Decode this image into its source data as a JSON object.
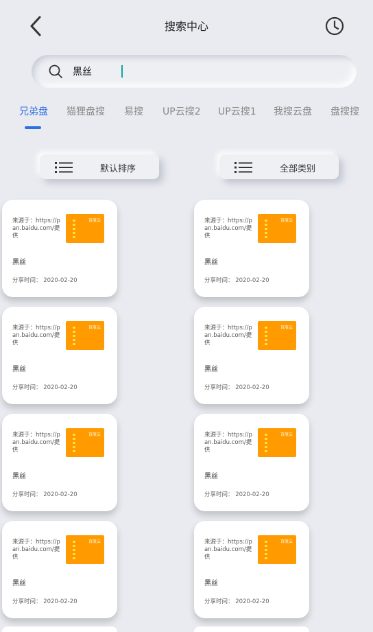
{
  "header": {
    "title": "搜索中心"
  },
  "search": {
    "value": "黑丝"
  },
  "tabs": [
    {
      "label": "兄弟盘",
      "active": true
    },
    {
      "label": "猫狸盘搜",
      "active": false
    },
    {
      "label": "易搜",
      "active": false
    },
    {
      "label": "UP云搜2",
      "active": false
    },
    {
      "label": "UP云搜1",
      "active": false
    },
    {
      "label": "我搜云盘",
      "active": false
    },
    {
      "label": "盘搜搜",
      "active": false
    }
  ],
  "filters": {
    "sort_label": "默认排序",
    "category_label": "全部类别"
  },
  "results": [
    {
      "source": "来源于：https://pan.baidu.com/提供",
      "keyword": "黑丝",
      "date": "分享时间：   2020-02-20",
      "thumb_label": "百度云"
    },
    {
      "source": "来源于：https://pan.baidu.com/提供",
      "keyword": "黑丝",
      "date": "分享时间：   2020-02-20",
      "thumb_label": "百度云"
    },
    {
      "source": "来源于：https://pan.baidu.com/提供",
      "keyword": "黑丝",
      "date": "分享时间：   2020-02-20",
      "thumb_label": "百度云"
    },
    {
      "source": "来源于：https://pan.baidu.com/提供",
      "keyword": "黑丝",
      "date": "分享时间：   2020-02-20",
      "thumb_label": "百度云"
    },
    {
      "source": "来源于：https://pan.baidu.com/提供",
      "keyword": "黑丝",
      "date": "分享时间：   2020-02-20",
      "thumb_label": "百度云"
    },
    {
      "source": "来源于：https://pan.baidu.com/提供",
      "keyword": "黑丝",
      "date": "分享时间：   2020-02-20",
      "thumb_label": "百度云"
    },
    {
      "source": "来源于：https://pan.baidu.com/提供",
      "keyword": "黑丝",
      "date": "分享时间：   2020-02-20",
      "thumb_label": "百度云"
    },
    {
      "source": "来源于：https://pan.baidu.com/提供",
      "keyword": "黑丝",
      "date": "分享时间：   2020-02-20",
      "thumb_label": "百度云"
    }
  ],
  "colors": {
    "accent": "#2f6fe4",
    "background": "#e9ebf0",
    "thumb": "#ff9a00"
  },
  "icons": {
    "back": "chevron-left-icon",
    "history": "clock-icon",
    "search": "search-icon",
    "list": "list-icon"
  }
}
